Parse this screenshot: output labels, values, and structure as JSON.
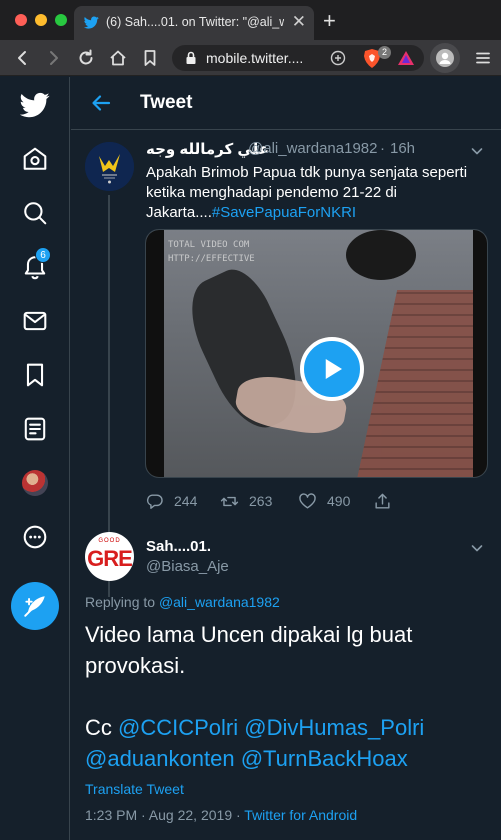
{
  "browser": {
    "tab_title": "(6) Sah....01. on Twitter: \"@ali_w",
    "tab_close": "✕",
    "new_tab": "+",
    "address": "mobile.twitter....",
    "brave_count": "2"
  },
  "sidebar": {
    "items": [
      "home-icon",
      "search-icon",
      "bell-icon",
      "mail-icon",
      "bookmark-icon",
      "lists-icon",
      "profile-avatar",
      "more-icon"
    ],
    "notification_count": "6",
    "compose": "compose-icon"
  },
  "header": {
    "title": "Tweet"
  },
  "tweet1": {
    "name": "علي كرمالله وجه",
    "handle": "@ali_wardana1982",
    "dot": "·",
    "time": "16h",
    "text": "Apakah Brimob Papua tdk punya senjata seperti ketika menghadapi pendemo 21-22 di Jakarta....",
    "hashtag": "#SavePapuaForNKRI",
    "media_caption_1": "TOTAL VIDEO COM",
    "media_caption_2": "HTTP://EFFECTIVE",
    "replies": "244",
    "retweets": "263",
    "likes": "490"
  },
  "tweet2": {
    "avatar_top": "GOOD",
    "avatar_text": "GRE",
    "name": "Sah....01.",
    "handle": "@Biasa_Aje",
    "replying_label": "Replying to",
    "replying_to": "@ali_wardana1982",
    "text_line1": "Video lama Uncen dipakai lg buat provokasi.",
    "cc": "Cc",
    "mention1": "@CCICPolri",
    "mention2": "@DivHumas_Polri",
    "mention3": "@aduankonten",
    "mention4": "@TurnBackHoax",
    "translate": "Translate Tweet",
    "time": "1:23 PM · Aug 22, 2019 · ",
    "source": "Twitter for Android"
  },
  "colors": {
    "background": "#15202b",
    "accent": "#1da1f2",
    "muted": "#8899a6",
    "border": "#38444d"
  }
}
